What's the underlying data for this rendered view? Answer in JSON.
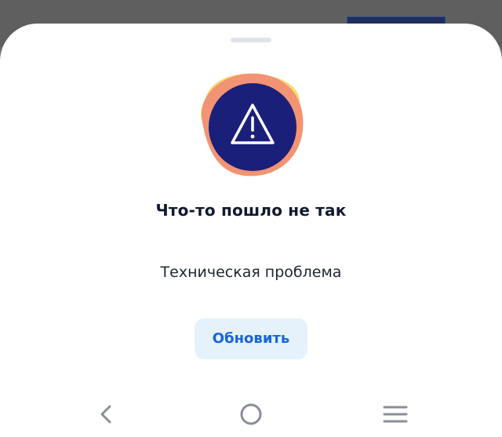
{
  "error_sheet": {
    "title": "Что-то пошло не так",
    "message": "Техническая проблема",
    "refresh_label": "Обновить"
  },
  "icons": {
    "illustration": "warning-triangle-icon",
    "back": "chevron-left-icon",
    "home": "circle-home-icon",
    "menu": "hamburger-menu-icon"
  },
  "colors": {
    "accent": "#1566d8",
    "button_bg": "#e5f1fb",
    "illustration_core": "#1a1f7a",
    "illustration_blob_coral": "#f29473",
    "illustration_blob_yellow": "#f7dc6f",
    "title": "#111a2e"
  }
}
